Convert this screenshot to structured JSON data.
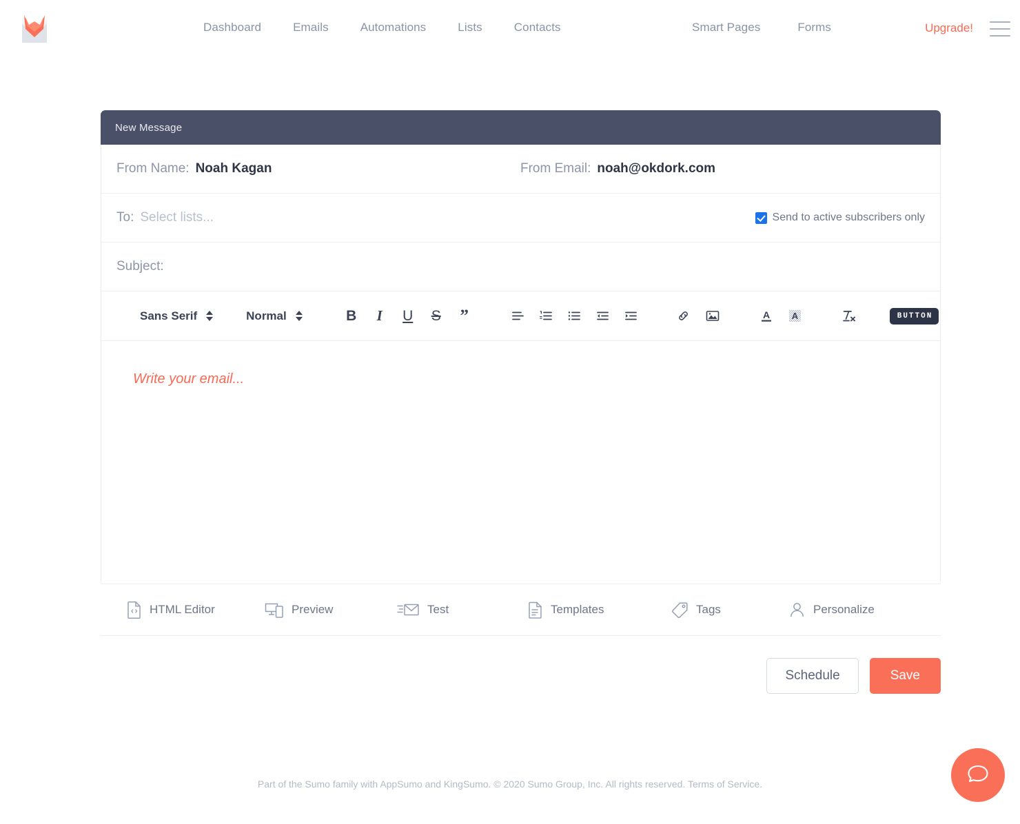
{
  "header": {
    "logo_name": "kingsumo-envelope-logo",
    "nav_main": [
      {
        "label": "Dashboard"
      },
      {
        "label": "Emails"
      },
      {
        "label": "Automations"
      },
      {
        "label": "Lists"
      },
      {
        "label": "Contacts"
      }
    ],
    "nav_right": [
      {
        "label": "Smart Pages"
      },
      {
        "label": "Forms"
      }
    ],
    "upgrade_label": "Upgrade!",
    "menu_icon": "hamburger-menu-icon",
    "accent_color": "#f96a55",
    "nav_text_color": "#8b93a7"
  },
  "composer": {
    "title": "New Message",
    "title_bar_color": "#4a5068",
    "from_name": {
      "label": "From Name:",
      "value": "Noah Kagan"
    },
    "from_email": {
      "label": "From Email:",
      "value": "noah@okdork.com"
    },
    "to": {
      "label": "To:",
      "placeholder": "Select lists..."
    },
    "active_only": {
      "label": "Send to active subscribers only",
      "checked": true,
      "check_color": "#1a73e8"
    },
    "subject": {
      "label": "Subject:",
      "value": "",
      "placeholder": ""
    },
    "toolbar": {
      "font_family": "Sans Serif",
      "font_size": "Normal",
      "buttons": [
        {
          "name": "bold-icon",
          "glyph": "B"
        },
        {
          "name": "italic-icon",
          "glyph": "I"
        },
        {
          "name": "underline-icon",
          "glyph": "U"
        },
        {
          "name": "strikethrough-icon",
          "glyph": "S"
        },
        {
          "name": "blockquote-icon",
          "glyph": "”"
        }
      ],
      "align_buttons": [
        {
          "name": "align-left-icon"
        },
        {
          "name": "ordered-list-icon"
        },
        {
          "name": "unordered-list-icon"
        },
        {
          "name": "outdent-icon"
        },
        {
          "name": "indent-icon"
        }
      ],
      "insert_buttons": [
        {
          "name": "link-icon"
        },
        {
          "name": "image-icon"
        }
      ],
      "color_buttons": [
        {
          "name": "text-color-icon"
        },
        {
          "name": "background-color-icon"
        }
      ],
      "clear_format_icon": "clear-formatting-icon",
      "button_pill_label": "BUTTON"
    },
    "editor": {
      "placeholder": "Write your email...",
      "placeholder_color": "#f96a55",
      "body": ""
    },
    "actions": [
      {
        "label": "HTML Editor",
        "icon": "html-code-file-icon"
      },
      {
        "label": "Preview",
        "icon": "devices-preview-icon"
      },
      {
        "label": "Test",
        "icon": "test-envelope-icon"
      },
      {
        "label": "Templates",
        "icon": "template-document-icon"
      },
      {
        "label": "Tags",
        "icon": "tag-icon"
      },
      {
        "label": "Personalize",
        "icon": "person-icon"
      }
    ],
    "footer_buttons": {
      "schedule_label": "Schedule",
      "save_label": "Save",
      "save_color": "#fa6f58"
    }
  },
  "page_footer": {
    "text_before": "Part of the Sumo family with AppSumo and KingSumo. © 2020 Sumo Group, Inc. All rights reserved.",
    "terms_label": "Terms of Service."
  },
  "chat_widget": {
    "icon": "chat-bubble-icon",
    "color": "#fa6f58"
  }
}
